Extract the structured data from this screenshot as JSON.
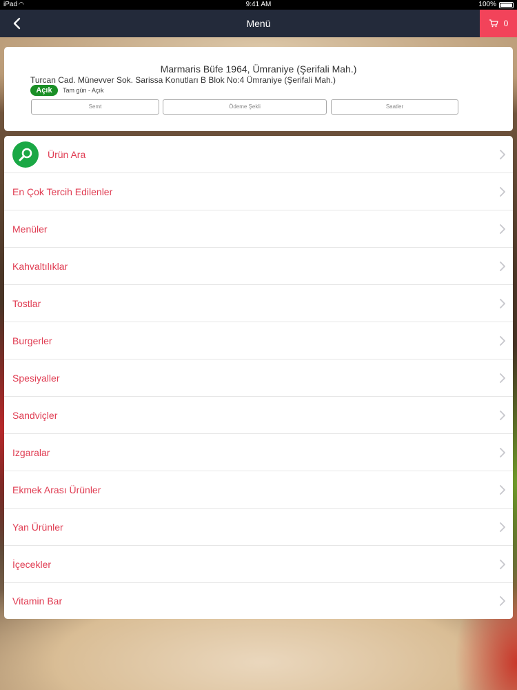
{
  "status_bar": {
    "device": "iPad",
    "time": "9:41 AM",
    "battery": "100%"
  },
  "nav": {
    "title": "Menü",
    "cart_count": "0"
  },
  "shop": {
    "name": "Marmaris Büfe 1964, Ümraniye (Şerifali Mah.)",
    "address": "Turcan Cad. Münevver Sok. Sarissa Konutları B Blok No:4 Ümraniye (Şerifali Mah.)",
    "status_badge": "Açık",
    "hours": "Tam gün - Açık",
    "buttons": {
      "semt": "Semt",
      "odeme": "Ödeme Şekli",
      "saatler": "Saatler"
    }
  },
  "menu": {
    "search_label": "Ürün Ara",
    "items": [
      "En Çok Tercih Edilenler",
      "Menüler",
      "Kahvaltılıklar",
      "Tostlar",
      "Burgerler",
      "Spesiyaller",
      "Sandviçler",
      "Izgaralar",
      "Ekmek Arası Ürünler",
      "Yan Ürünler",
      "İçecekler",
      "Vitamin Bar"
    ]
  },
  "colors": {
    "nav_bg": "#232a3a",
    "cart_bg": "#f2435a",
    "menu_text": "#e03c52",
    "open_badge": "#1a8f26",
    "search_icon_bg": "#1aa845"
  },
  "icons": {
    "back": "chevron-left-icon",
    "cart": "cart-icon",
    "search": "search-icon",
    "row_chevron": "chevron-right-icon"
  }
}
